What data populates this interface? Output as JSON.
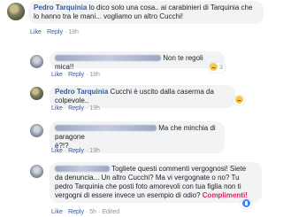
{
  "comments": [
    {
      "author": "Pedro Tarquinia",
      "text_line1": "lo dico solo una cosa.. ai carabinieri di Tarquinia che",
      "text_line2": "lo hanno tra le mani... vogliamo un altro Cucchi!",
      "like": "Like",
      "reply": "Reply",
      "time": "19h"
    },
    {
      "author": "",
      "text": "Non te regoli mica!!",
      "like": "Like",
      "reply": "Reply",
      "time": "19h",
      "reaction_count": "3"
    },
    {
      "author": "Pedro Tarquinia",
      "text": "Cucchi è uscito dalla caserma da colpevole..",
      "like": "Like",
      "reply": "Reply",
      "time": "19h"
    },
    {
      "author": "",
      "text_line1": "Ma che minchia di paragone",
      "text_line2": "è?!?",
      "like": "Like",
      "reply": "Reply",
      "time": "19h"
    },
    {
      "author": "",
      "text_line1": "Togliete questi commenti vergognosi! Siete",
      "text_line2": "da denuncia... Un altro Cucchi? Ma vi vergognate o no? Tu",
      "text_line3": "pedro Tarquinia che posti foto amorevoli con tua figlia non ti",
      "text_line4_pre": "vergogni di essere invece un esempio di odio?",
      "text_line4_highlight": "Complimenti!",
      "like": "Like",
      "reply": "Reply",
      "time": "5h",
      "edited": "Edited"
    }
  ],
  "separator": "·",
  "colors": {
    "name": "#385898",
    "bubble": "#f2f3f5",
    "meta_link": "#385898",
    "time": "#90949c",
    "highlight": "#e0245e"
  }
}
